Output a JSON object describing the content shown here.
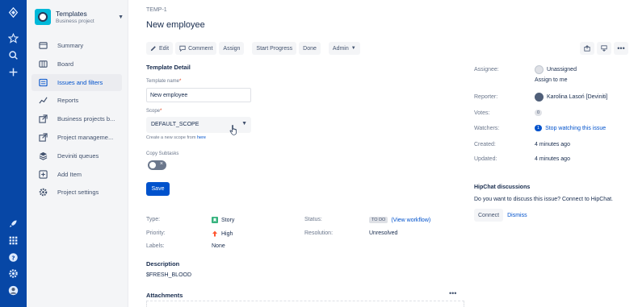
{
  "project": {
    "name": "Templates",
    "type": "Business project"
  },
  "sidebar": {
    "items": [
      {
        "label": "Summary",
        "icon": "summary-icon"
      },
      {
        "label": "Board",
        "icon": "board-icon"
      },
      {
        "label": "Issues and filters",
        "icon": "issues-filter-icon",
        "active": true
      },
      {
        "label": "Reports",
        "icon": "reports-icon"
      },
      {
        "label": "Business projects b...",
        "icon": "external-link-icon"
      },
      {
        "label": "Project manageme...",
        "icon": "external-link-icon"
      },
      {
        "label": "Deviniti queues",
        "icon": "stack-icon"
      },
      {
        "label": "Add Item",
        "icon": "add-item-icon"
      },
      {
        "label": "Project settings",
        "icon": "gear-icon"
      }
    ]
  },
  "issue": {
    "key": "TEMP-1",
    "title": "New employee"
  },
  "toolbar": {
    "edit": "Edit",
    "comment": "Comment",
    "assign": "Assign",
    "start_progress": "Start Progress",
    "done": "Done",
    "admin": "Admin"
  },
  "form": {
    "section": "Template Detail",
    "name_label": "Template name",
    "name_value": "New employee",
    "scope_label": "Scope",
    "scope_value": "DEFAULT_SCOPE",
    "helper_text": "Create a new scope from",
    "helper_link": "here",
    "copy_subtasks_label": "Copy Subtasks",
    "save_label": "Save"
  },
  "details": {
    "type_label": "Type:",
    "type_value": "Story",
    "priority_label": "Priority:",
    "priority_value": "High",
    "labels_label": "Labels:",
    "labels_value": "None",
    "status_label": "Status:",
    "status_value": "TO DO",
    "status_link": "(View workflow)",
    "resolution_label": "Resolution:",
    "resolution_value": "Unresolved"
  },
  "description": {
    "heading": "Description",
    "value": "$FRESH_BLOOD"
  },
  "attachments": {
    "heading": "Attachments",
    "more": "•••"
  },
  "people": {
    "assignee_label": "Assignee:",
    "assignee_value": "Unassigned",
    "assign_to_me": "Assign to me",
    "reporter_label": "Reporter:",
    "reporter_value": "Karolina Lasoń [Deviniti]",
    "votes_label": "Votes:",
    "votes_value": "0",
    "watchers_label": "Watchers:",
    "watchers_count": "1",
    "watchers_link": "Stop watching this issue",
    "created_label": "Created:",
    "created_value": "4 minutes ago",
    "updated_label": "Updated:",
    "updated_value": "4 minutes ago"
  },
  "hipchat": {
    "heading": "HipChat discussions",
    "text": "Do you want to discuss this issue? Connect to HipChat.",
    "connect": "Connect",
    "dismiss": "Dismiss"
  },
  "colors": {
    "nav": "#0747A6",
    "accent": "#0052CC",
    "story": "#36B37E",
    "high": "#FF5630"
  }
}
